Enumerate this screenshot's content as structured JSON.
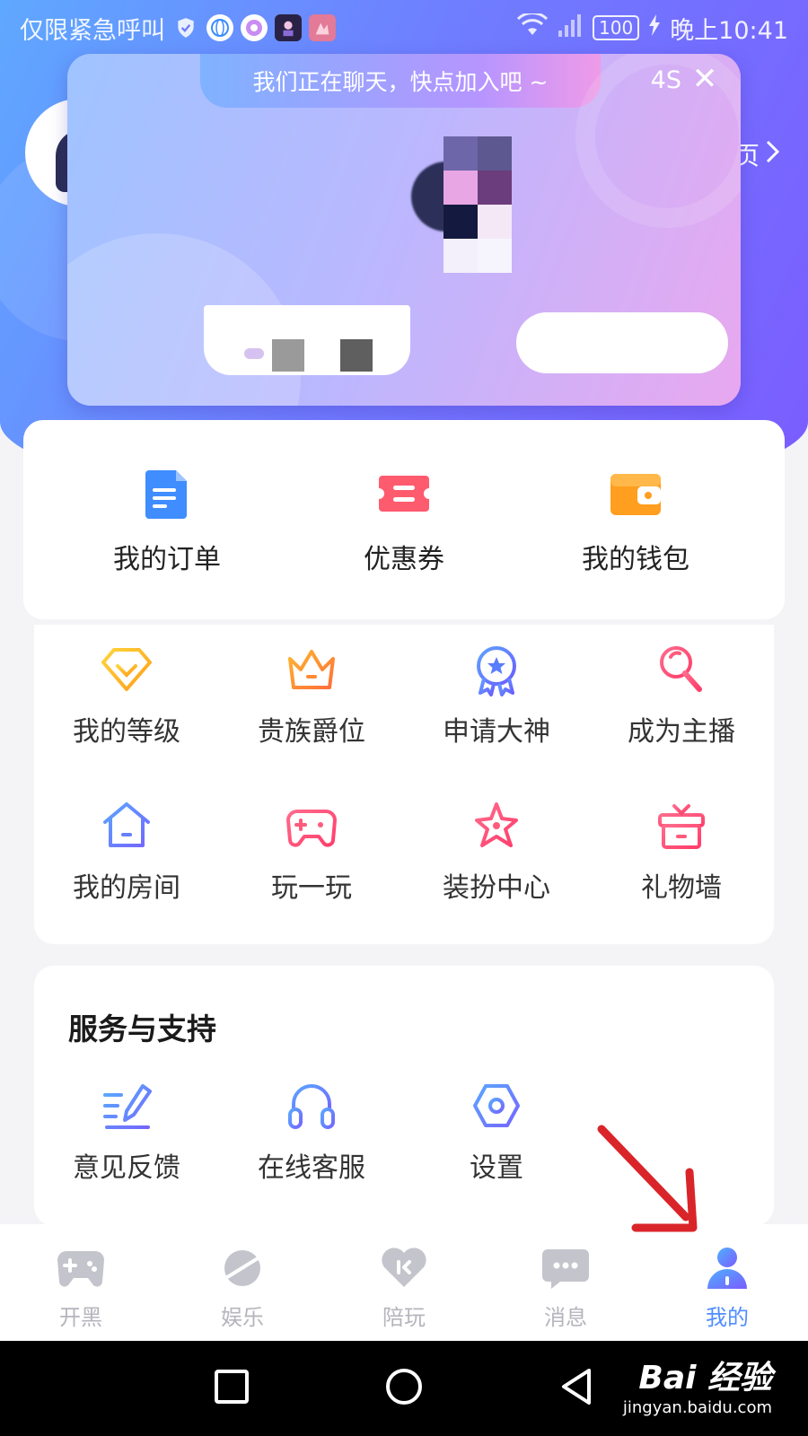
{
  "status_bar": {
    "carrier": "仅限紧急呼叫",
    "battery": "100",
    "time": "晚上10:41"
  },
  "profile": {
    "link_text": "页"
  },
  "popup": {
    "banner": "我们正在聊天，快点加入吧 ~",
    "countdown": "4S",
    "close": "✕"
  },
  "quick_actions": [
    {
      "label": "我的订单",
      "icon": "order-document-icon",
      "color": "#3f8dff"
    },
    {
      "label": "优惠券",
      "icon": "coupon-ticket-icon",
      "color": "#ff5b6e"
    },
    {
      "label": "我的钱包",
      "icon": "wallet-icon",
      "color": "#ff9e1f"
    }
  ],
  "features": [
    {
      "label": "我的等级",
      "icon": "diamond-level-icon"
    },
    {
      "label": "贵族爵位",
      "icon": "crown-icon"
    },
    {
      "label": "申请大神",
      "icon": "medal-badge-icon"
    },
    {
      "label": "成为主播",
      "icon": "microphone-icon"
    },
    {
      "label": "我的房间",
      "icon": "house-icon"
    },
    {
      "label": "玩一玩",
      "icon": "gamepad-icon"
    },
    {
      "label": "装扮中心",
      "icon": "star-icon"
    },
    {
      "label": "礼物墙",
      "icon": "gift-icon"
    }
  ],
  "services": {
    "title": "服务与支持",
    "items": [
      {
        "label": "意见反馈",
        "icon": "feedback-pen-icon"
      },
      {
        "label": "在线客服",
        "icon": "headset-icon"
      },
      {
        "label": "设置",
        "icon": "settings-hexagon-icon"
      }
    ]
  },
  "tabs": [
    {
      "label": "开黑",
      "icon": "gamepad-tab-icon",
      "active": false
    },
    {
      "label": "娱乐",
      "icon": "planet-tab-icon",
      "active": false
    },
    {
      "label": "陪玩",
      "icon": "heart-tab-icon",
      "active": false
    },
    {
      "label": "消息",
      "icon": "message-tab-icon",
      "active": false
    },
    {
      "label": "我的",
      "icon": "person-tab-icon",
      "active": true
    }
  ],
  "watermark": {
    "main": "Bai 经验",
    "sub": "jingyan.baidu.com"
  },
  "colors": {
    "accent": "#4f8dff",
    "tab_inactive": "#b5b5bd",
    "arrow": "#d9252a"
  }
}
